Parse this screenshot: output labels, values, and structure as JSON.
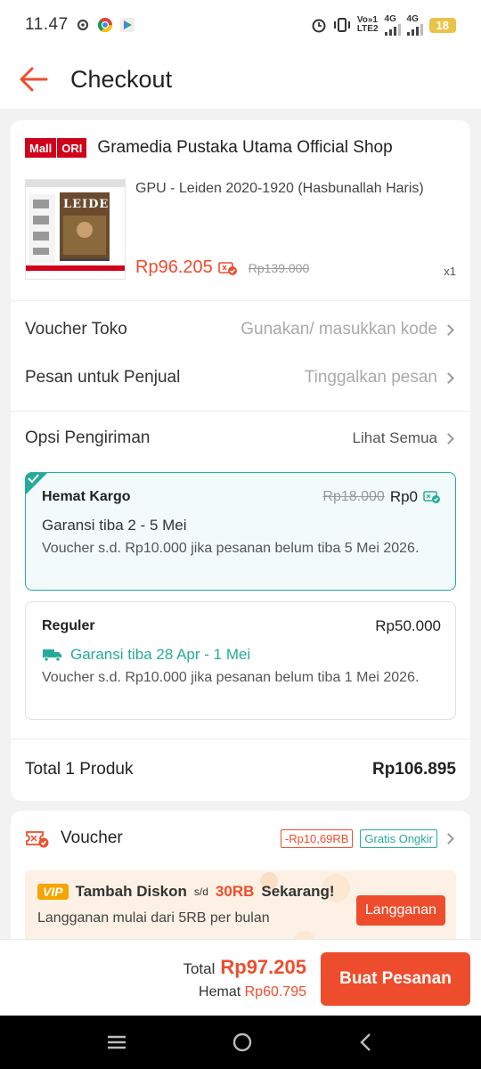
{
  "status_bar": {
    "time": "11.47",
    "network_label_1": "Vo»1",
    "network_label_2": "LTE2",
    "signal_1": "4G",
    "signal_2": "4G",
    "battery": "18"
  },
  "header": {
    "title": "Checkout"
  },
  "shop": {
    "badge_mall": "Mall",
    "badge_ori": "ORI",
    "name": "Gramedia Pustaka Utama Official Shop"
  },
  "product": {
    "name": "GPU - Leiden 2020-1920 (Hasbunallah Haris)",
    "price": "Rp96.205",
    "old_price": "Rp139.000",
    "quantity": "x1",
    "cover_title": "LEIDEN"
  },
  "rows": {
    "voucher_toko_label": "Voucher Toko",
    "voucher_toko_value": "Gunakan/ masukkan kode",
    "pesan_label": "Pesan untuk Penjual",
    "pesan_placeholder": "Tinggalkan pesan"
  },
  "shipping": {
    "label": "Opsi Pengiriman",
    "see_all": "Lihat Semua",
    "options": [
      {
        "name": "Hemat Kargo",
        "old_price": "Rp18.000",
        "price": "Rp0",
        "guarantee": "Garansi tiba 2 - 5 Mei",
        "voucher": "Voucher s.d.  Rp10.000 jika pesanan belum tiba 5 Mei 2026.",
        "selected": true
      },
      {
        "name": "Reguler",
        "price": "Rp50.000",
        "guarantee": "Garansi tiba 28 Apr - 1 Mei",
        "voucher": "Voucher s.d.  Rp10.000 jika pesanan belum tiba 1 Mei 2026.",
        "selected": false
      }
    ]
  },
  "total": {
    "label": "Total 1 Produk",
    "value": "Rp106.895"
  },
  "voucher": {
    "label": "Voucher",
    "discount_tag": "-Rp10,69RB",
    "free_shipping_tag": "Gratis Ongkir"
  },
  "vip": {
    "badge": "VIP",
    "headline": "Tambah Diskon",
    "sd": "s/d",
    "amount": "30RB",
    "headline_end": "Sekarang!",
    "subtitle": "Langganan mulai dari 5RB per bulan",
    "button": "Langganan"
  },
  "bottom": {
    "total_label": "Total",
    "total_value": "Rp97.205",
    "save_label": "Hemat",
    "save_value": "Rp60.795",
    "order_button": "Buat Pesanan"
  },
  "colors": {
    "accent": "#ee4d2d",
    "teal": "#26aa99",
    "mall_red": "#d0011b"
  }
}
